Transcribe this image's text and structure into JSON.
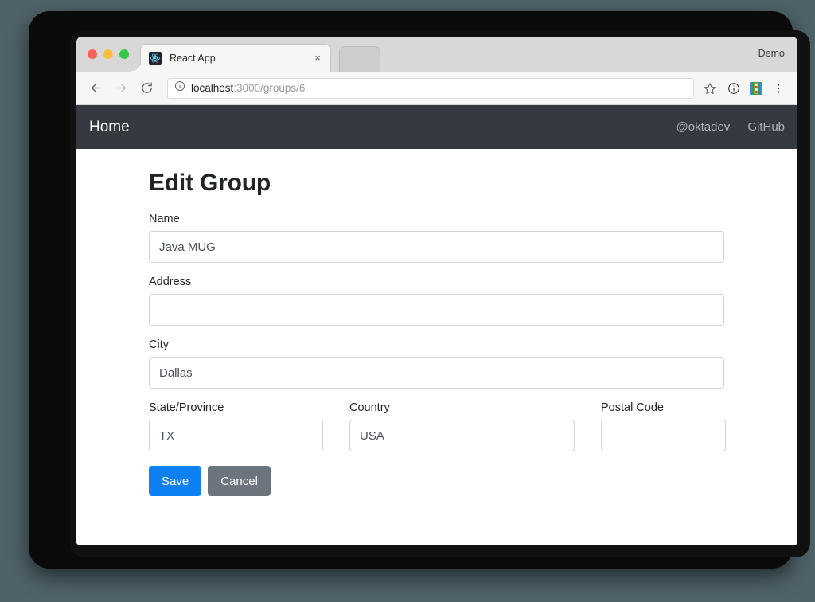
{
  "browser": {
    "traffic_lights": [
      "close",
      "minimize",
      "maximize"
    ],
    "tab": {
      "title": "React App",
      "favicon": "react-logo-icon",
      "close_label": "×"
    },
    "new_tab_stub": "",
    "profile_label": "Demo",
    "toolbar": {
      "back_icon": "back-arrow-icon",
      "forward_icon": "forward-arrow-icon",
      "reload_icon": "reload-icon",
      "page_info_icon": "info-circle-icon",
      "url_host": "localhost",
      "url_path": ":3000/groups/6",
      "bookmark_icon": "star-icon",
      "secondary_icon": "info-circle-icon",
      "extension_icon": "extension-icon",
      "menu_icon": "three-dot-menu-icon"
    }
  },
  "navbar": {
    "brand": "Home",
    "links": [
      {
        "label": "@oktadev"
      },
      {
        "label": "GitHub"
      }
    ],
    "background": "#343a40"
  },
  "main": {
    "title": "Edit Group",
    "fields": [
      {
        "label": "Name",
        "value": "Java MUG",
        "placeholder": ""
      },
      {
        "label": "Address",
        "value": "",
        "placeholder": ""
      },
      {
        "label": "City",
        "value": "Dallas",
        "placeholder": ""
      }
    ],
    "row_fields": [
      {
        "label": "State/Province",
        "value": "TX",
        "placeholder": ""
      },
      {
        "label": "Country",
        "value": "USA",
        "placeholder": ""
      },
      {
        "label": "Postal Code",
        "value": "",
        "placeholder": ""
      }
    ],
    "buttons": {
      "save": "Save",
      "cancel": "Cancel"
    },
    "colors": {
      "primary": "#0d80f2",
      "secondary": "#6c757d",
      "input_border": "#ced4da",
      "text": "#212529"
    }
  }
}
